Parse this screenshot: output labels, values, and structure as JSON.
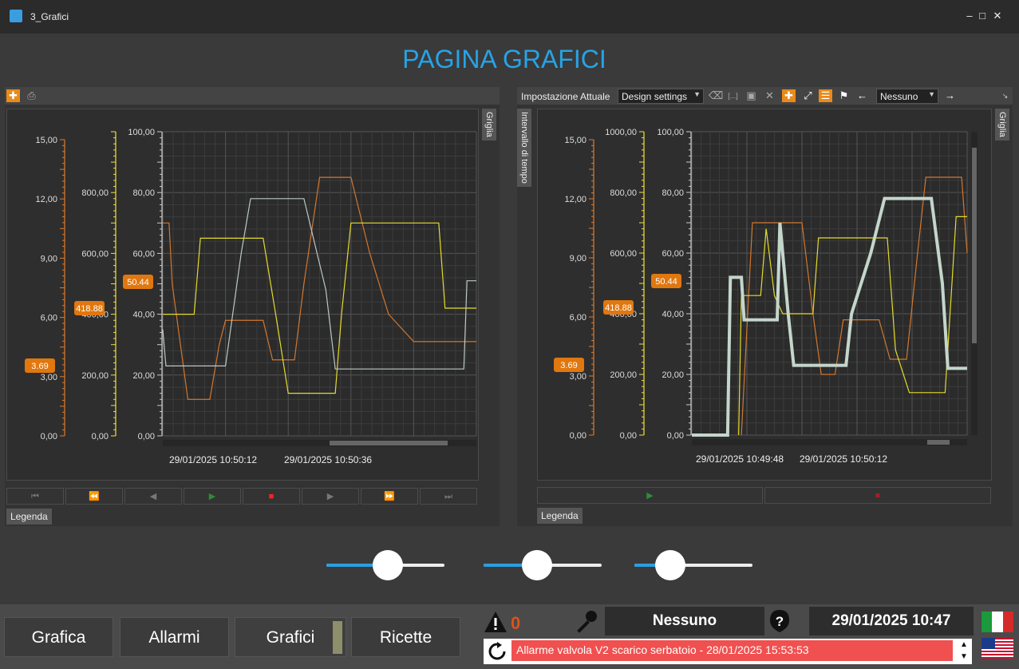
{
  "window": {
    "title": "3_Grafici",
    "min_icon": "minimize-icon",
    "max_icon": "maximize-icon",
    "close_icon": "close-icon"
  },
  "page": {
    "title": "PAGINA GRAFICI"
  },
  "left_panel": {
    "side_tab": "Griglia",
    "legend_tab": "Legenda",
    "value_labels": {
      "orange": "3.69",
      "orange2": "418.88",
      "yellow": "50.44"
    },
    "time_labels": [
      "29/01/2025 10:50:12",
      "29/01/2025 10:50:36"
    ]
  },
  "right_panel": {
    "toolbar_label": "Impostazione Attuale",
    "settings_select": "Design settings",
    "cursor_select": "Nessuno",
    "side_tab_left": "Intervallo di tempo",
    "side_tab_right": "Griglia",
    "legend_tab": "Legenda",
    "value_labels": {
      "orange": "3.69",
      "orange2": "418.88",
      "yellow": "50.44"
    },
    "time_labels": [
      "29/01/2025 10:49:48",
      "29/01/2025 10:50:12"
    ]
  },
  "chart_data": [
    {
      "type": "line",
      "axes": [
        {
          "color": "#e07a2a",
          "range": [
            0,
            15
          ],
          "ticks": [
            "0,00",
            "3,00",
            "6,00",
            "9,00",
            "12,00",
            "15,00"
          ]
        },
        {
          "color": "#f0e23a",
          "range": [
            0,
            1000
          ],
          "ticks": [
            "0,00",
            "200,00",
            "400,00",
            "600,00",
            "800,00"
          ]
        },
        {
          "color": "#cccccc",
          "range": [
            0,
            100
          ],
          "ticks": [
            "0,00",
            "20,00",
            "40,00",
            "60,00",
            "80,00",
            "100,00"
          ]
        }
      ],
      "x_labels": [
        "29/01/2025 10:50:12",
        "29/01/2025 10:50:36"
      ],
      "grid": true,
      "series": [
        {
          "color": "#d2772f",
          "points": [
            [
              0,
              70
            ],
            [
              2,
              70
            ],
            [
              3,
              50
            ],
            [
              8,
              12
            ],
            [
              15,
              12
            ],
            [
              18,
              30
            ],
            [
              20,
              38
            ],
            [
              32,
              38
            ],
            [
              35,
              25
            ],
            [
              42,
              25
            ],
            [
              45,
              50
            ],
            [
              50,
              85
            ],
            [
              60,
              85
            ],
            [
              66,
              60
            ],
            [
              72,
              40
            ],
            [
              80,
              31
            ],
            [
              100,
              31
            ]
          ]
        },
        {
          "color": "#e5dc2a",
          "points": [
            [
              0,
              40
            ],
            [
              10,
              40
            ],
            [
              12,
              65
            ],
            [
              32,
              65
            ],
            [
              36,
              40
            ],
            [
              40,
              14
            ],
            [
              55,
              14
            ],
            [
              57,
              40
            ],
            [
              60,
              70
            ],
            [
              88,
              70
            ],
            [
              90,
              42
            ],
            [
              100,
              42
            ]
          ]
        },
        {
          "color": "#bcc8c2",
          "points": [
            [
              0,
              35
            ],
            [
              1,
              23
            ],
            [
              20,
              23
            ],
            [
              25,
              60
            ],
            [
              28,
              78
            ],
            [
              45,
              78
            ],
            [
              52,
              48
            ],
            [
              55,
              22
            ],
            [
              96,
              22
            ],
            [
              97,
              51
            ],
            [
              100,
              51
            ]
          ]
        }
      ]
    },
    {
      "type": "line",
      "axes": [
        {
          "color": "#e07a2a",
          "range": [
            0,
            15
          ],
          "ticks": [
            "0,00",
            "3,00",
            "6,00",
            "9,00",
            "12,00",
            "15,00"
          ]
        },
        {
          "color": "#f0e23a",
          "range": [
            0,
            1000
          ],
          "ticks": [
            "0,00",
            "200,00",
            "400,00",
            "600,00",
            "800,00",
            "1000,00"
          ]
        },
        {
          "color": "#cccccc",
          "range": [
            0,
            100
          ],
          "ticks": [
            "0,00",
            "20,00",
            "40,00",
            "60,00",
            "80,00",
            "100,00"
          ]
        }
      ],
      "x_labels": [
        "29/01/2025 10:49:48",
        "29/01/2025 10:50:12"
      ],
      "grid": true,
      "series": [
        {
          "color": "#d2772f",
          "points": [
            [
              18,
              0
            ],
            [
              22,
              70
            ],
            [
              40,
              70
            ],
            [
              44,
              40
            ],
            [
              47,
              20
            ],
            [
              52,
              20
            ],
            [
              55,
              38
            ],
            [
              68,
              38
            ],
            [
              72,
              25
            ],
            [
              78,
              25
            ],
            [
              82,
              60
            ],
            [
              85,
              85
            ],
            [
              98,
              85
            ],
            [
              100,
              60
            ]
          ]
        },
        {
          "color": "#e5dc2a",
          "points": [
            [
              17,
              0
            ],
            [
              18,
              46
            ],
            [
              25,
              46
            ],
            [
              27,
              68
            ],
            [
              30,
              46
            ],
            [
              33,
              40
            ],
            [
              44,
              40
            ],
            [
              46,
              65
            ],
            [
              71,
              65
            ],
            [
              74,
              28
            ],
            [
              79,
              14
            ],
            [
              92,
              14
            ],
            [
              96,
              72
            ],
            [
              100,
              72
            ]
          ]
        },
        {
          "color": "#c4d6cc",
          "width": 4,
          "points": [
            [
              0,
              0
            ],
            [
              13,
              0
            ],
            [
              14,
              52
            ],
            [
              18,
              52
            ],
            [
              19,
              38
            ],
            [
              31,
              38
            ],
            [
              32,
              70
            ],
            [
              35,
              40
            ],
            [
              37,
              23
            ],
            [
              56,
              23
            ],
            [
              58,
              40
            ],
            [
              65,
              60
            ],
            [
              70,
              78
            ],
            [
              87,
              78
            ],
            [
              91,
              50
            ],
            [
              93,
              22
            ],
            [
              100,
              22
            ]
          ]
        }
      ]
    }
  ],
  "sliders": [
    {
      "value": 0.5
    },
    {
      "value": 0.45
    },
    {
      "value": 0.3
    }
  ],
  "footer": {
    "tabs": [
      "Grafica",
      "Allarmi",
      "Grafici",
      "Ricette"
    ],
    "alarm_count": "0",
    "user": "Nessuno",
    "datetime": "29/01/2025 10:47",
    "alarm_message": "Allarme valvola V2 scarico serbatoio - 28/01/2025 15:53:53"
  },
  "colors": {
    "accent": "#27a3e6",
    "orange": "#e98a1a",
    "alarm": "#f05050"
  }
}
